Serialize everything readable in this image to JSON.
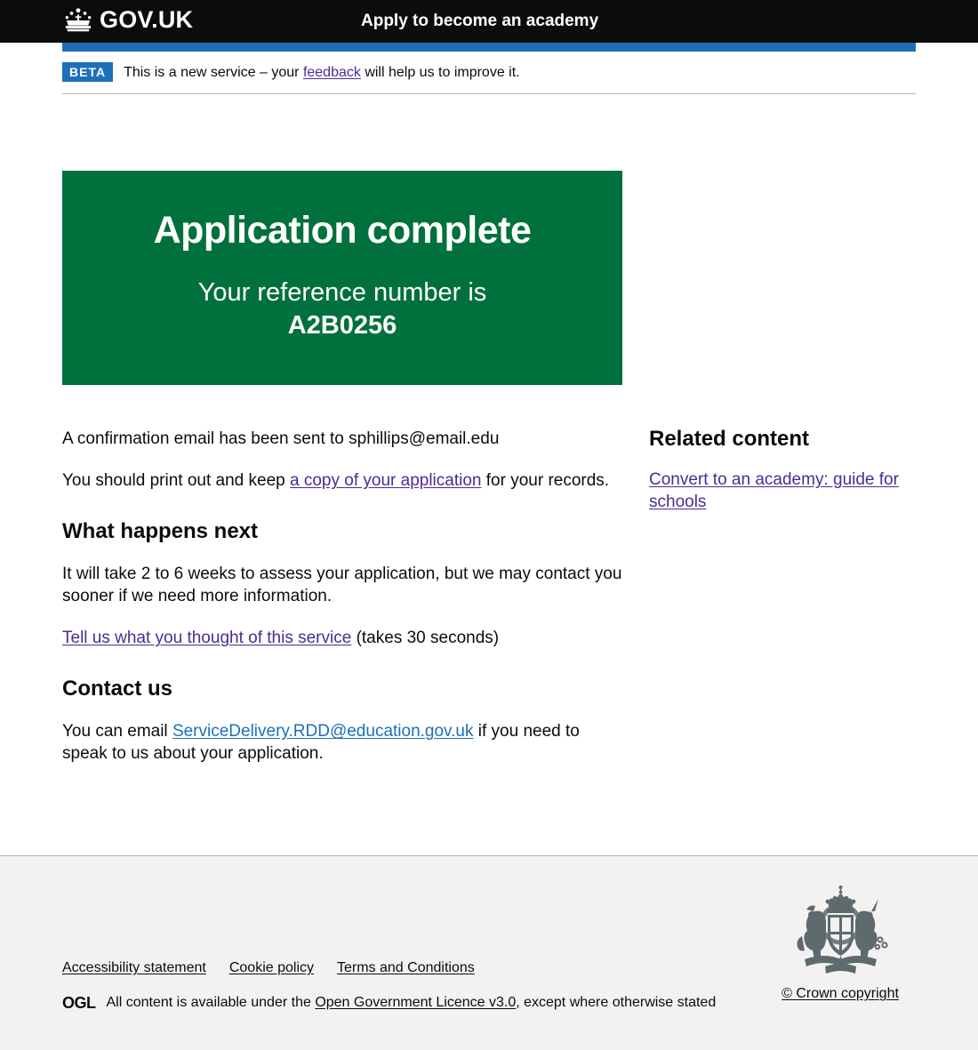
{
  "header": {
    "logo_text": "GOV.UK",
    "logo_icon": "crown-icon",
    "service_name": "Apply to become an academy"
  },
  "phase_banner": {
    "tag": "BETA",
    "text_before": "This is a new service – your ",
    "link": "feedback",
    "text_after": " will help us to improve it."
  },
  "panel": {
    "title": "Application complete",
    "body_lead": "Your reference number is",
    "reference_number": "A2B0256",
    "background_color": "#00703c"
  },
  "main": {
    "confirmation_email_text": "A confirmation email has been sent to sphillips@email.edu",
    "print_text_before": "You should print out and keep ",
    "print_link": "a copy of your application",
    "print_text_after": " for your records.",
    "what_happens_next_heading": "What happens next",
    "what_happens_next_body": "It will take 2 to 6 weeks to assess your application, but we may contact you sooner if we need more information.",
    "feedback_link": "Tell us what you thought of this service",
    "feedback_suffix": " (takes 30 seconds)",
    "contact_heading": "Contact us",
    "contact_text_before": "You can email ",
    "contact_email": "ServiceDelivery.RDD@education.gov.uk",
    "contact_text_after": " if you need to speak to us about your application."
  },
  "aside": {
    "heading": "Related content",
    "link": "Convert to an academy: guide for schools"
  },
  "footer": {
    "links": [
      "Accessibility statement",
      "Cookie policy",
      "Terms and Conditions"
    ],
    "ogl_logo": "OGL",
    "licence_text_before": "All content is available under the ",
    "licence_link": "Open Government Licence v3.0",
    "licence_text_after": ", except where otherwise stated",
    "crest_icon": "royal-coat-of-arms-icon",
    "copyright": "© Crown copyright"
  },
  "colors": {
    "black": "#0b0c0c",
    "blue": "#1d70b8",
    "green": "#00703c",
    "link_visited": "#4c2c92",
    "footer_bg": "#f3f2f1"
  }
}
